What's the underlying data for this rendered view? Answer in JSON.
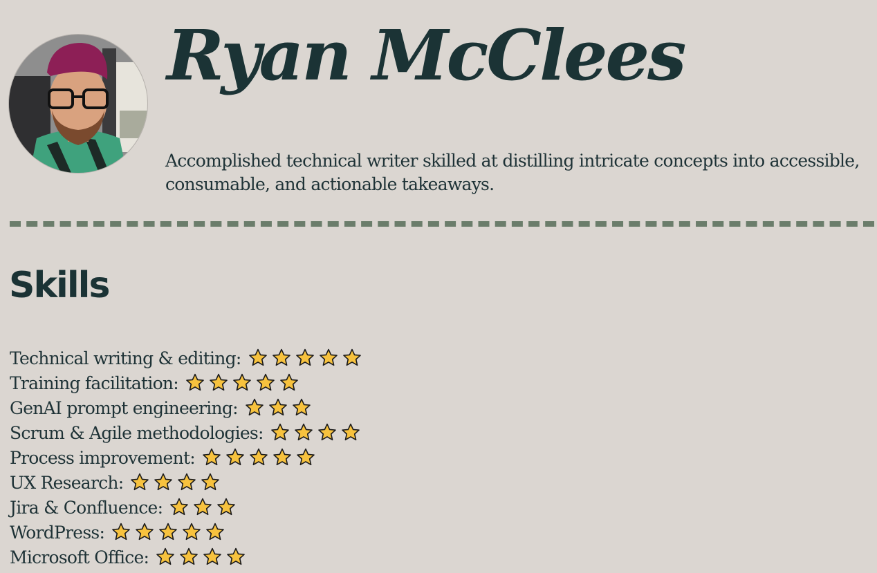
{
  "profile": {
    "name": "Ryan McClees",
    "tagline": "Accomplished technical writer skilled at distilling intricate concepts into accessible, consumable, and actionable takeaways."
  },
  "skills_section": {
    "title": "Skills",
    "star_icon": "star-icon",
    "star_color": "#f7c23e",
    "items": [
      {
        "label": "Technical writing & editing:",
        "rating": 5
      },
      {
        "label": "Training facilitation:",
        "rating": 5
      },
      {
        "label": "GenAI prompt engineering:",
        "rating": 3
      },
      {
        "label": "Scrum & Agile methodologies:",
        "rating": 4
      },
      {
        "label": "Process improvement:",
        "rating": 5
      },
      {
        "label": "UX Research:",
        "rating": 4
      },
      {
        "label": "Jira & Confluence:",
        "rating": 3
      },
      {
        "label": "WordPress:",
        "rating": 5
      },
      {
        "label": "Microsoft Office:",
        "rating": 4
      }
    ]
  },
  "colors": {
    "background": "#dbd6d1",
    "text": "#1e3236",
    "divider": "#6b7d6b"
  }
}
